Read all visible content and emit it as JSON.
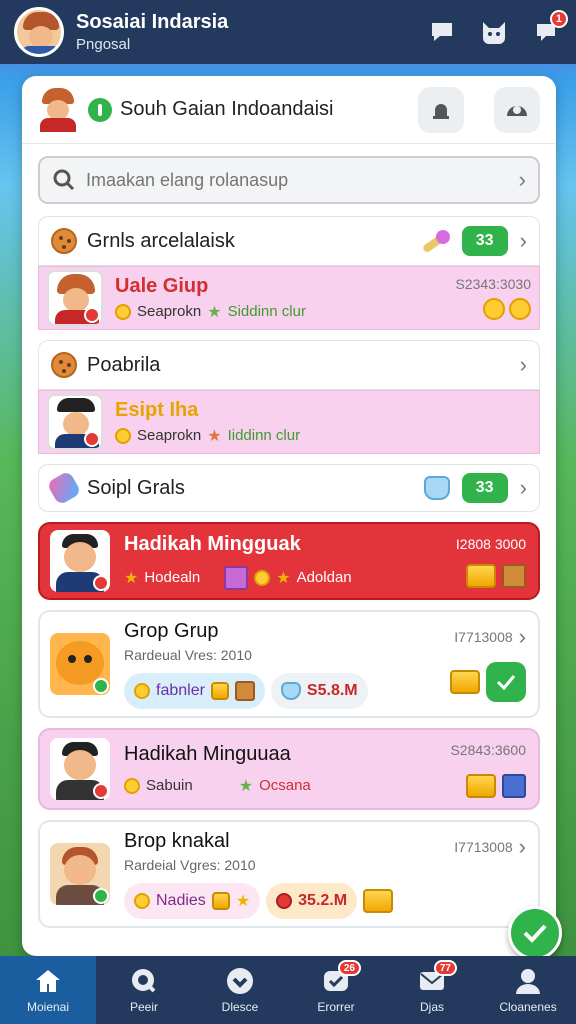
{
  "header": {
    "title": "Sosaiai Indarsia",
    "subtitle": "Pngosal",
    "icons": [
      {
        "name": "chat-icon",
        "badge": ""
      },
      {
        "name": "cat-icon",
        "badge": ""
      },
      {
        "name": "notification-icon",
        "badge": "1"
      }
    ]
  },
  "panel": {
    "title": "Souh Gaian Indoandaisi",
    "search_placeholder": "Imaakan elang rolanasup",
    "btn_badges": [
      "",
      ""
    ]
  },
  "sections": [
    {
      "label": "Grnls arcelalaisk",
      "count": "33",
      "card": {
        "name": "Uale Giup",
        "sub_a": "Seaprokn",
        "sub_b": "Siddinn clur",
        "stamp": "S2343:3030"
      }
    },
    {
      "label": "Poabrila",
      "card": {
        "name": "Esipt Iha",
        "sub_a": "Seaprokn",
        "sub_b": "Iiddinn clur"
      }
    },
    {
      "label": "Soipl Grals",
      "count": "33"
    }
  ],
  "cards": {
    "red": {
      "title": "Hadikah Mingguak",
      "stamp": "I2808 3000",
      "sub_a": "Hodealn",
      "sub_b": "Adoldan"
    },
    "group1": {
      "title": "Grop Grup",
      "sub": "Rardeual Vres: 2010",
      "stamp": "I7713008",
      "chip_label": "fabnler",
      "amount": "S5.8.M"
    },
    "pink": {
      "title": "Hadikah Minguuaa",
      "stamp": "S2843:3600",
      "sub_a": "Sabuin",
      "sub_b": "Ocsana"
    },
    "group2": {
      "title": "Brop knakal",
      "sub": "Rardeial Vgres: 2010",
      "stamp": "I7713008",
      "chip_label": "Nadies",
      "amount": "35.2.M"
    }
  },
  "bottom_nav": [
    {
      "label": "Moienai",
      "icon": "home-icon",
      "badge": "",
      "active": true
    },
    {
      "label": "Peeir",
      "icon": "search-icon",
      "badge": "",
      "active": false
    },
    {
      "label": "Dlesce",
      "icon": "heart-icon",
      "badge": "",
      "active": false
    },
    {
      "label": "Erorrer",
      "icon": "chat-icon",
      "badge": "26",
      "active": false
    },
    {
      "label": "Djas",
      "icon": "mail-icon",
      "badge": "77",
      "active": false
    },
    {
      "label": "Cloanenes",
      "icon": "user-icon",
      "badge": "",
      "active": false
    }
  ],
  "colors": {
    "bar": "#233a5e",
    "accent_green": "#2fb34a",
    "accent_red": "#e3343c",
    "card_pink": "#f8d1ee"
  }
}
